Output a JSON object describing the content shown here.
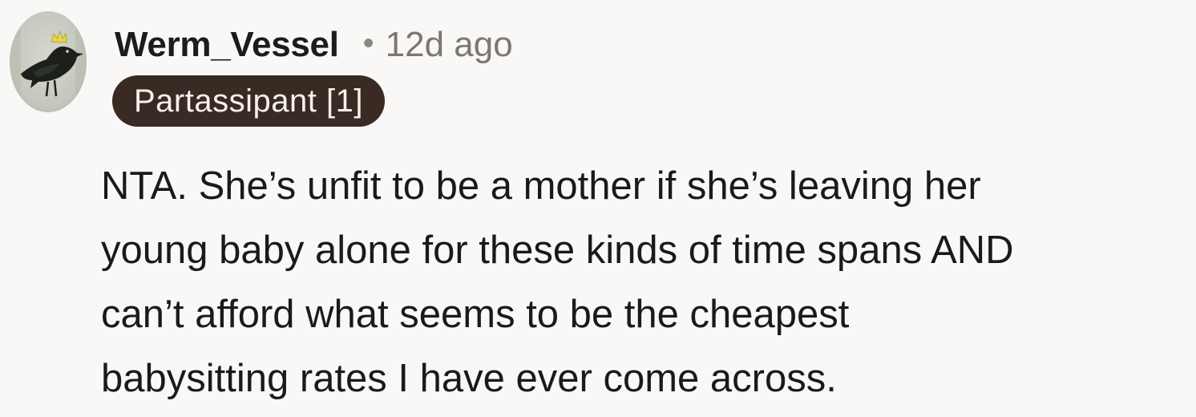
{
  "comment": {
    "author": "Werm_Vessel",
    "separator": "•",
    "timestamp": "12d ago",
    "flair": "Partassipant [1]",
    "avatar_icon": "crowned-bird-avatar-icon",
    "body_lines": [
      "NTA. She’s unfit to be a mother if she’s leaving her",
      "young baby alone for these kinds of time spans AND",
      "can’t afford what seems to be the cheapest",
      "babysitting rates I have ever come across."
    ]
  },
  "colors": {
    "background": "#f9f8f6",
    "flair_background": "#3a2a24",
    "flair_text": "#f5f1ec",
    "timestamp": "#7a7774"
  }
}
